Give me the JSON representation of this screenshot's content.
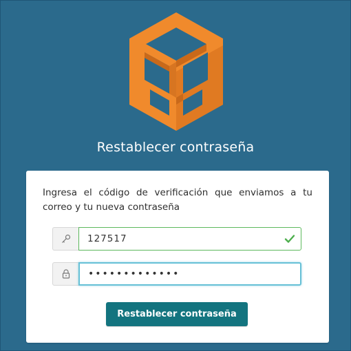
{
  "page": {
    "title": "Restablecer contraseña",
    "colors": {
      "background": "#2b6a8c",
      "logo_primary": "#f08a2c",
      "logo_dark": "#c9691a",
      "button": "#13747f",
      "valid_border": "#5cb85c",
      "focus_border": "#66c0d6"
    }
  },
  "form": {
    "instructions": "Ingresa el código de verificación que enviamos a tu correo y tu nueva contraseña",
    "code": {
      "icon": "key-icon",
      "value": "127517",
      "status_icon": "checkmark-icon"
    },
    "password": {
      "icon": "lock-icon",
      "value": "•••••••••••••"
    },
    "submit_label": "Restablecer contraseña"
  }
}
